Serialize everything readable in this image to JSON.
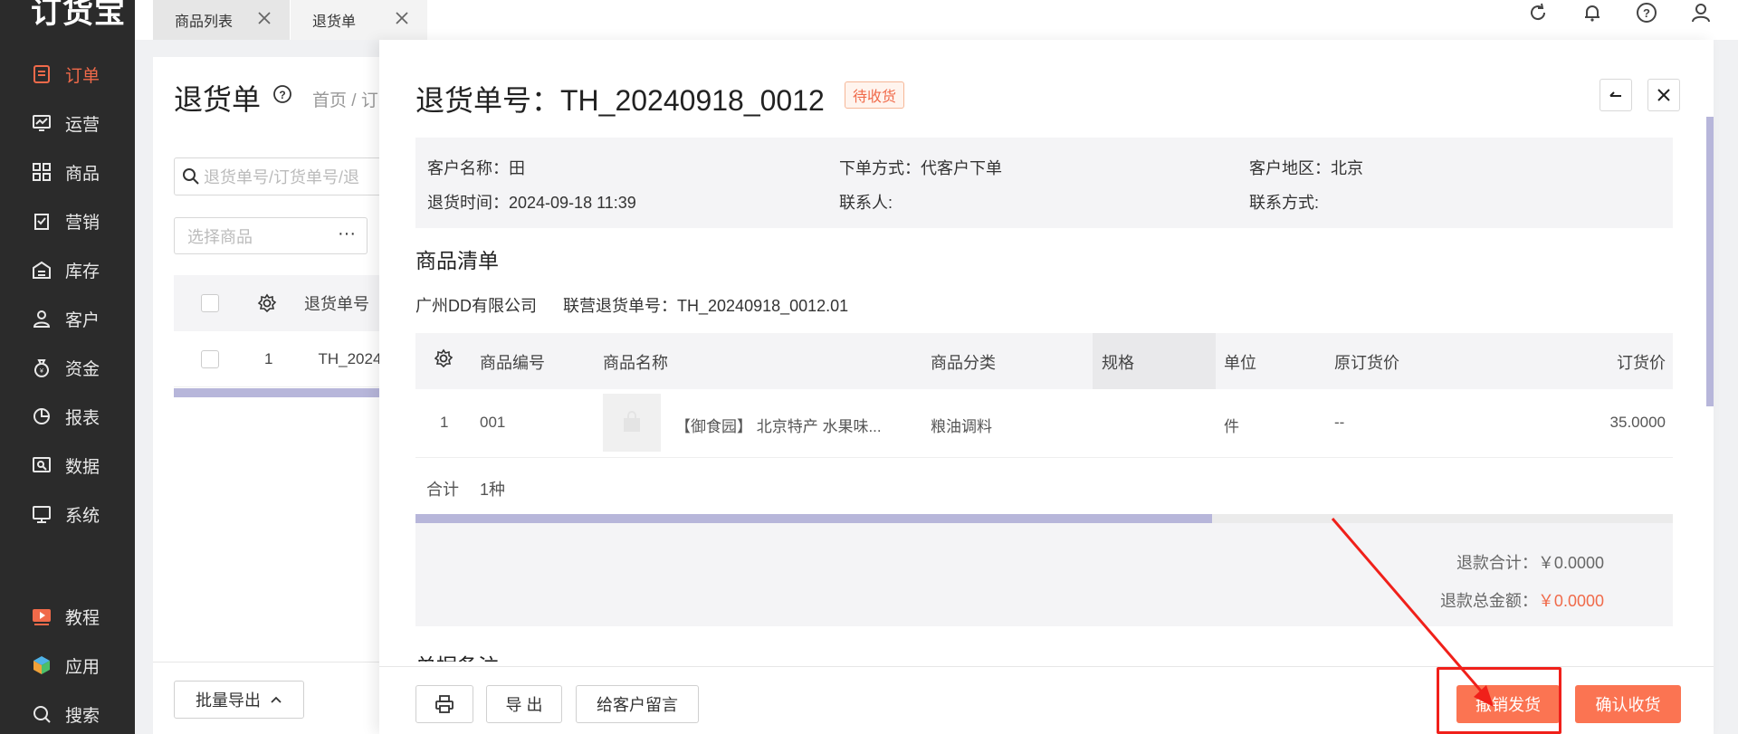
{
  "app": {
    "logo": "订货宝"
  },
  "sidebar": {
    "items": [
      {
        "label": "订单",
        "icon": "order-icon"
      },
      {
        "label": "运营",
        "icon": "operation-icon"
      },
      {
        "label": "商品",
        "icon": "product-icon"
      },
      {
        "label": "营销",
        "icon": "marketing-icon"
      },
      {
        "label": "库存",
        "icon": "inventory-icon"
      },
      {
        "label": "客户",
        "icon": "customer-icon"
      },
      {
        "label": "资金",
        "icon": "funds-icon"
      },
      {
        "label": "报表",
        "icon": "report-icon"
      },
      {
        "label": "数据",
        "icon": "data-icon"
      },
      {
        "label": "系统",
        "icon": "system-icon"
      }
    ],
    "bottom": [
      {
        "label": "教程",
        "icon": "tutorial-icon"
      },
      {
        "label": "应用",
        "icon": "apps-icon"
      },
      {
        "label": "搜索",
        "icon": "search-icon"
      }
    ]
  },
  "tabs": [
    {
      "label": "商品列表"
    },
    {
      "label": "退货单"
    }
  ],
  "bg": {
    "title": "退货单",
    "breadcrumb": "首页 / 订",
    "search_placeholder": "退货单号/订货单号/退",
    "select_placeholder": "选择商品",
    "dots": "···",
    "col_no": "退货单号",
    "row_index": "1",
    "row_no": "TH_2024",
    "export_label": "批量导出"
  },
  "drawer": {
    "title": "退货单号：TH_20240918_0012",
    "status": "待收货",
    "info": {
      "customer_name": "客户名称：田",
      "order_method": "下单方式：代客户下单",
      "region": "客户地区：北京",
      "return_time": "退货时间：2024-09-18 11:39",
      "contact": "联系人:",
      "contact_method": "联系方式:"
    },
    "section_title": "商品清单",
    "supplier": "广州DD有限公司",
    "joint_return_no": "联营退货单号：TH_20240918_0012.01",
    "table": {
      "headers": [
        "商品编号",
        "商品名称",
        "商品分类",
        "规格",
        "单位",
        "原订货价",
        "订货价"
      ],
      "rows": [
        {
          "index": "1",
          "code": "001",
          "name": "【御食园】 北京特产 水果味...",
          "category": "粮油调料",
          "spec": "",
          "unit": "件",
          "orig_price": "--",
          "price": "35.0000"
        }
      ],
      "total_label": "合计",
      "total_value": "1种"
    },
    "refund_total_label": "退款合计：",
    "refund_total_value": "￥0.0000",
    "refund_amount_label": "退款总金额：",
    "refund_amount_value": "￥0.0000",
    "remark_title": "单据备注",
    "buttons": {
      "export": "导 出",
      "message": "给客户留言",
      "cancel_ship": "撤销发货",
      "confirm_receipt": "确认收货"
    }
  },
  "colors": {
    "accent": "#f06a4a",
    "primary_button": "#fb7452",
    "sidebar": "#2b2b2b",
    "annotation": "#f0201a"
  }
}
